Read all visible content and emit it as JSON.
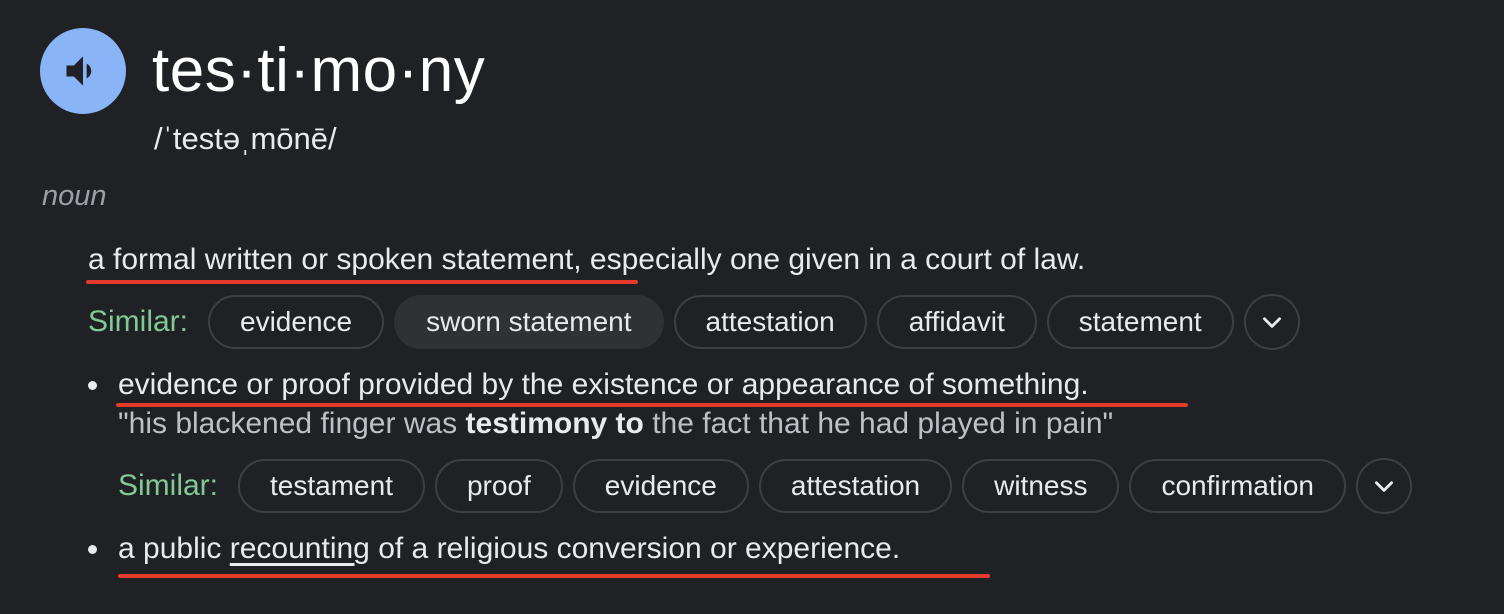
{
  "entry": {
    "word": "tes·ti·mo·ny",
    "phonetic": "/ˈtestəˌmōnē/",
    "part_of_speech": "noun"
  },
  "senses": [
    {
      "definition_part1": "a formal written or spoken statement,",
      "definition_part2": " especially one given in a court of law.",
      "similar_label": "Similar:",
      "similar": [
        "evidence",
        "sworn statement",
        "attestation",
        "affidavit",
        "statement"
      ]
    },
    {
      "definition": "evidence or proof provided by the existence or appearance of something.",
      "example_before": "\"his blackened finger was ",
      "example_bold": "testimony to",
      "example_after": " the fact that he had played in pain\"",
      "similar_label": "Similar:",
      "similar": [
        "testament",
        "proof",
        "evidence",
        "attestation",
        "witness",
        "confirmation"
      ]
    },
    {
      "definition_before": "a public ",
      "definition_link": "recounting",
      "definition_after": " of a religious conversion or experience."
    }
  ],
  "icons": {
    "speaker": "speaker-icon",
    "expand": "chevron-down-icon"
  },
  "colors": {
    "speaker_bg": "#8ab4f8",
    "similar_label": "#81c995",
    "annotation": "#e53b2c",
    "background": "#202124"
  }
}
